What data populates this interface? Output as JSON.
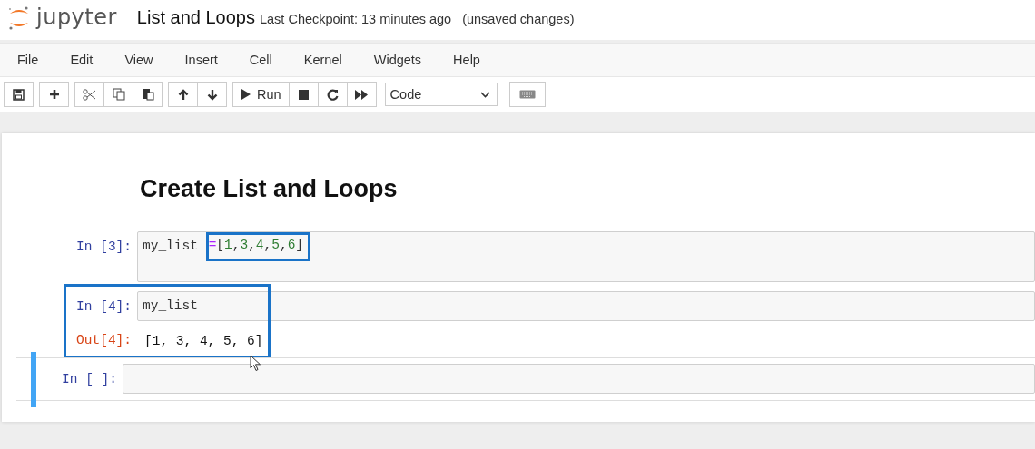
{
  "header": {
    "logo_text": "jupyter",
    "notebook_name": "List and Loops",
    "checkpoint": "Last Checkpoint: 13 minutes ago",
    "save_status": "(unsaved changes)"
  },
  "menu": [
    "File",
    "Edit",
    "View",
    "Insert",
    "Cell",
    "Kernel",
    "Widgets",
    "Help"
  ],
  "toolbar": [
    [
      {
        "kind": "save"
      }
    ],
    [
      {
        "kind": "add"
      }
    ],
    [
      {
        "kind": "cut"
      },
      {
        "kind": "copy"
      },
      {
        "kind": "paste"
      }
    ],
    [
      {
        "kind": "up"
      },
      {
        "kind": "down"
      }
    ],
    [
      {
        "kind": "run",
        "label": "Run"
      },
      {
        "kind": "stop"
      },
      {
        "kind": "restart"
      },
      {
        "kind": "fast-forward"
      }
    ]
  ],
  "cell_type": {
    "value": "Code"
  },
  "heading": "Create List and Loops",
  "cells": [
    {
      "prompt": "In [3]:",
      "selected": false,
      "highlighted": false,
      "code": [
        {
          "highlighted": false,
          "tokens": [
            {
              "kind": "name",
              "text": "my_list "
            }
          ]
        },
        {
          "highlighted": true,
          "tokens": [
            {
              "kind": "operator",
              "text": "="
            },
            {
              "kind": "punct",
              "text": "["
            },
            {
              "kind": "number",
              "text": "1"
            },
            {
              "kind": "punct",
              "text": ","
            },
            {
              "kind": "number",
              "text": "3"
            },
            {
              "kind": "punct",
              "text": ","
            },
            {
              "kind": "number",
              "text": "4"
            },
            {
              "kind": "punct",
              "text": ","
            },
            {
              "kind": "number",
              "text": "5"
            },
            {
              "kind": "punct",
              "text": ","
            },
            {
              "kind": "number",
              "text": "6"
            },
            {
              "kind": "punct",
              "text": "]"
            }
          ]
        }
      ]
    },
    {
      "prompt": "In [4]:",
      "selected": false,
      "highlighted": true,
      "code": [
        {
          "highlighted": false,
          "tokens": [
            {
              "kind": "name",
              "text": "my_list"
            }
          ]
        }
      ],
      "output_prompt": "Out[4]:",
      "output": "[1, 3, 4, 5, 6]"
    },
    {
      "prompt": "In [ ]:",
      "selected": true,
      "highlighted": false
    }
  ]
}
